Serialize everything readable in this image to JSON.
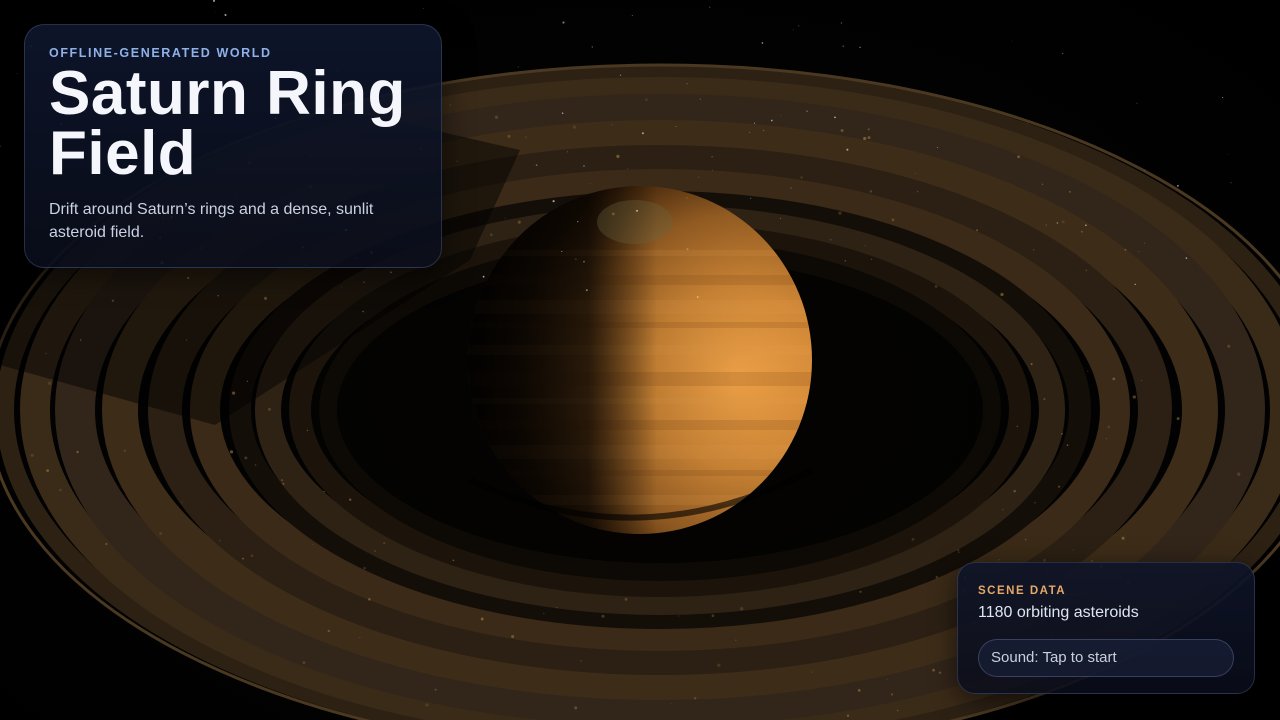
{
  "header": {
    "eyebrow": "OFFLINE-GENERATED WORLD",
    "title_line1": "Saturn Ring",
    "title_line2": "Field",
    "subtitle": "Drift around Saturn’s rings and a dense, sunlit asteroid field."
  },
  "scene_data": {
    "label": "SCENE DATA",
    "asteroid_count_text": "1180 orbiting asteroids",
    "sound_button_label": "Sound: Tap to start"
  },
  "colors": {
    "planet_light": "#f2a245",
    "planet_mid": "#c47d2e",
    "planet_dark": "#2a1606",
    "ring_band": "#3a2b1a",
    "ring_gap": "#0e0a06",
    "accent_blue": "#8fb1e8",
    "accent_orange": "#e6a869"
  },
  "icons": {
    "planet": "saturn-planet-icon",
    "asteroid": "asteroid-icon"
  }
}
